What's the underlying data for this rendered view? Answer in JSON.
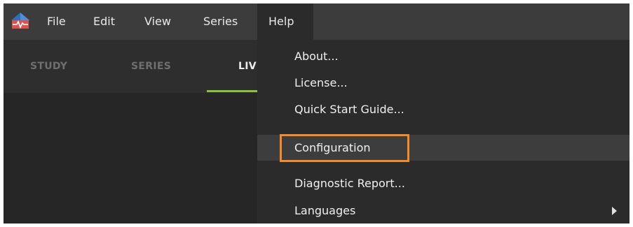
{
  "menubar": {
    "logo_icon": "app-logo-icon",
    "items": [
      {
        "label": "File"
      },
      {
        "label": "Edit"
      },
      {
        "label": "View"
      },
      {
        "label": "Series"
      },
      {
        "label": "Help"
      }
    ],
    "active_item": "Help"
  },
  "tabs": [
    {
      "label": "STUDY"
    },
    {
      "label": "SERIES"
    },
    {
      "label": "LIV"
    }
  ],
  "help_menu": {
    "items": [
      {
        "label": "About..."
      },
      {
        "label": "License..."
      },
      {
        "label": "Quick Start Guide..."
      },
      {
        "label": "Configuration"
      },
      {
        "label": "Diagnostic Report..."
      },
      {
        "label": "Languages",
        "submenu_icon": "chevron-right-icon"
      }
    ],
    "highlighted": "Configuration"
  },
  "colors": {
    "accent_underline": "#8ac13f",
    "callout_border": "#f28a30",
    "menubar_bg": "#3c3c3c",
    "dropdown_bg": "#2b2b2b"
  }
}
